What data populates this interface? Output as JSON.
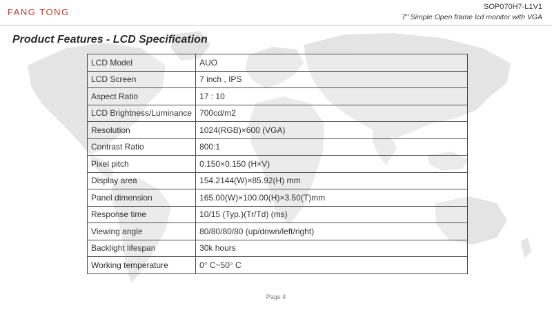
{
  "header": {
    "logo_text": "FANG TONG",
    "doc_code": "SOP070H7-L1V1",
    "doc_subtitle": "7\" Simple Open frame lcd monitor with VGA"
  },
  "page_title": "Product Features - LCD Specification",
  "spec_table": {
    "rows": [
      {
        "label": "LCD Model",
        "value": "AUO"
      },
      {
        "label": "LCD Screen",
        "value": "7 inch , IPS"
      },
      {
        "label": "Aspect Ratio",
        "value": "17 : 10"
      },
      {
        "label": "LCD Brightness/Luminance",
        "value": "700cd/m2"
      },
      {
        "label": "Resolution",
        "value": "1024(RGB)×600 (VGA)"
      },
      {
        "label": "Contrast Ratio",
        "value": "800:1"
      },
      {
        "label": "Pixel pitch",
        "value": "0.150×0.150 (H×V)"
      },
      {
        "label": "Display area",
        "value": "154.2144(W)×85.92(H) mm"
      },
      {
        "label": "Panel dimension",
        "value": "165.00(W)×100.00(H)×3.50(T)mm"
      },
      {
        "label": "Response time",
        "value": "10/15 (Typ.)(Tr/Td) (ms)"
      },
      {
        "label": "Viewing angle",
        "value": "80/80/80/80 (up/down/left/right)"
      },
      {
        "label": "Backlight lifespan",
        "value": "30k hours"
      },
      {
        "label": "Working temperature",
        "value": "0° C~50° C"
      }
    ]
  },
  "footer": {
    "page_label": "Page 4"
  },
  "colors": {
    "logo": "#c0392b",
    "border": "#4a4a4a",
    "map": "#d9d9d9"
  }
}
